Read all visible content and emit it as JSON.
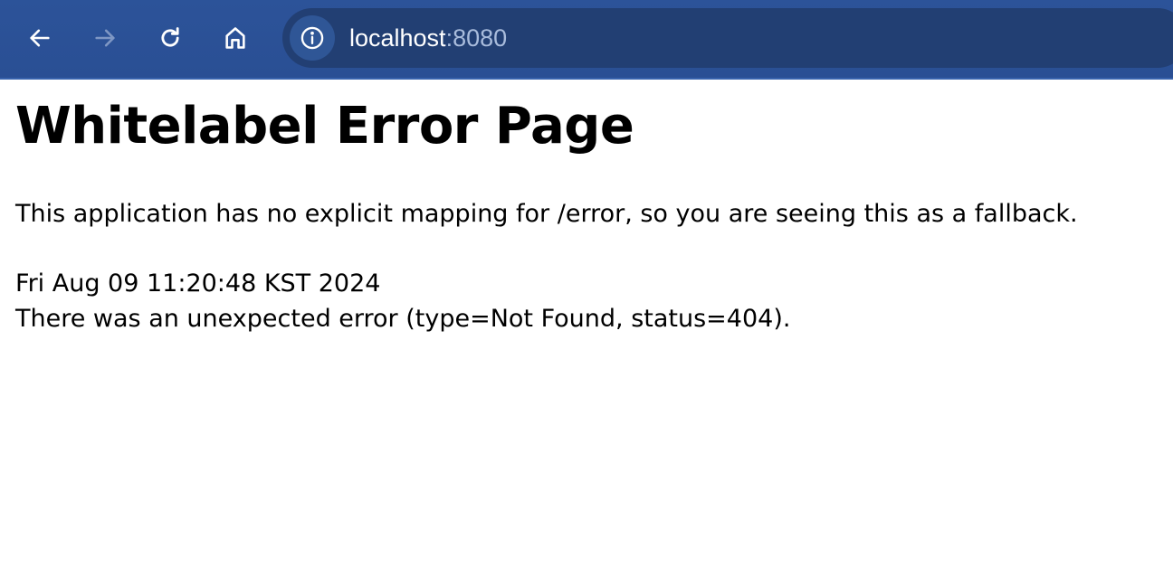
{
  "browser": {
    "url_host": "localhost",
    "url_port": ":8080",
    "icons": {
      "back": "arrow-left-icon",
      "forward": "arrow-right-icon",
      "reload": "reload-icon",
      "home": "home-icon",
      "site_info": "info-icon"
    },
    "colors": {
      "toolbar": "#2c5399",
      "omnibox": "#223f73",
      "text": "#ffffff",
      "port_text": "#a9bcdc"
    }
  },
  "page": {
    "title": "Whitelabel Error Page",
    "description": "This application has no explicit mapping for /error, so you are seeing this as a fallback.",
    "timestamp": "Fri Aug 09 11:20:48 KST 2024",
    "error_message": "There was an unexpected error (type=Not Found, status=404)."
  }
}
